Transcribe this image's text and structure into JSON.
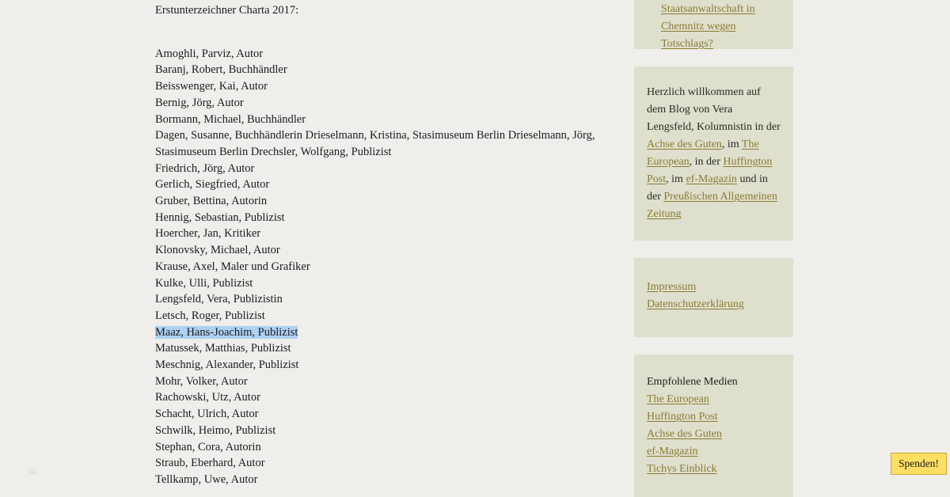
{
  "page": {
    "background_color": "#efeeea",
    "widget_background_color": "#dfdfce",
    "link_color": "#8a7c30",
    "selection_color": "#aed0f2"
  },
  "article": {
    "intro": "Erstunterzeichner Charta 2017:",
    "selected_text": "Maaz, Hans-Joachim, Publizist",
    "signatories": [
      "Amoghli, Parviz, Autor",
      "Baranj, Robert, Buchhändler",
      "Beisswenger, Kai, Autor",
      "Bernig, Jörg, Autor",
      "Bormann, Michael, Buchhändler",
      "Dagen, Susanne, Buchhändlerin Drieselmann, Kristina, Stasimuseum Berlin Drieselmann, Jörg, Stasimuseum Berlin Drechsler, Wolfgang, Publizist",
      "Friedrich, Jörg, Autor",
      "Gerlich, Siegfried, Autor",
      "Gruber, Bettina, Autorin",
      "Hennig, Sebastian, Publizist",
      "Hoercher, Jan, Kritiker",
      "Klonovsky, Michael, Autor",
      "Krause, Axel, Maler und Grafiker",
      "Kulke, Ulli, Publizist",
      "Lengsfeld, Vera, Publizistin",
      "Letsch, Roger, Publizist",
      "Maaz, Hans-Joachim, Publizist",
      "Matussek, Matthias, Publizist",
      "Meschnig, Alexander, Publizist",
      "Mohr, Volker, Autor",
      "Rachowski, Utz, Autor",
      "Schacht, Ulrich, Autor",
      "Schwilk, Heimo, Publizist",
      "Stephan, Cora, Autorin",
      "Straub, Eberhard, Autor",
      "Tellkamp, Uwe, Autor"
    ]
  },
  "sidebar": {
    "recent_posts": {
      "items": [
        "Warum ermittelt die Staatsanwaltschaft in Chemnitz wegen Totschlags?"
      ]
    },
    "welcome": {
      "part1": "Herzlich willkommen auf dem Blog von Vera Lengsfeld, Kolumnistin in der ",
      "link1": "Achse des Guten",
      "part2": ", im ",
      "link2": "The European",
      "part3": ", in der ",
      "link3": "Huffington Post",
      "part4": ", im ",
      "link4": "ef-Magazin",
      "part5": " und in der ",
      "link5": "Preußischen Allgemeinen Zeitung"
    },
    "legal": {
      "links": [
        "Impressum",
        "Datenschutzerklärung"
      ]
    },
    "media": {
      "heading": "Empfohlene Medien",
      "links": [
        "The European",
        "Huffington Post",
        "Achse des Guten",
        "ef-Magazin",
        "Tichys Einblick"
      ]
    }
  },
  "donate": {
    "label": "Spenden!"
  }
}
